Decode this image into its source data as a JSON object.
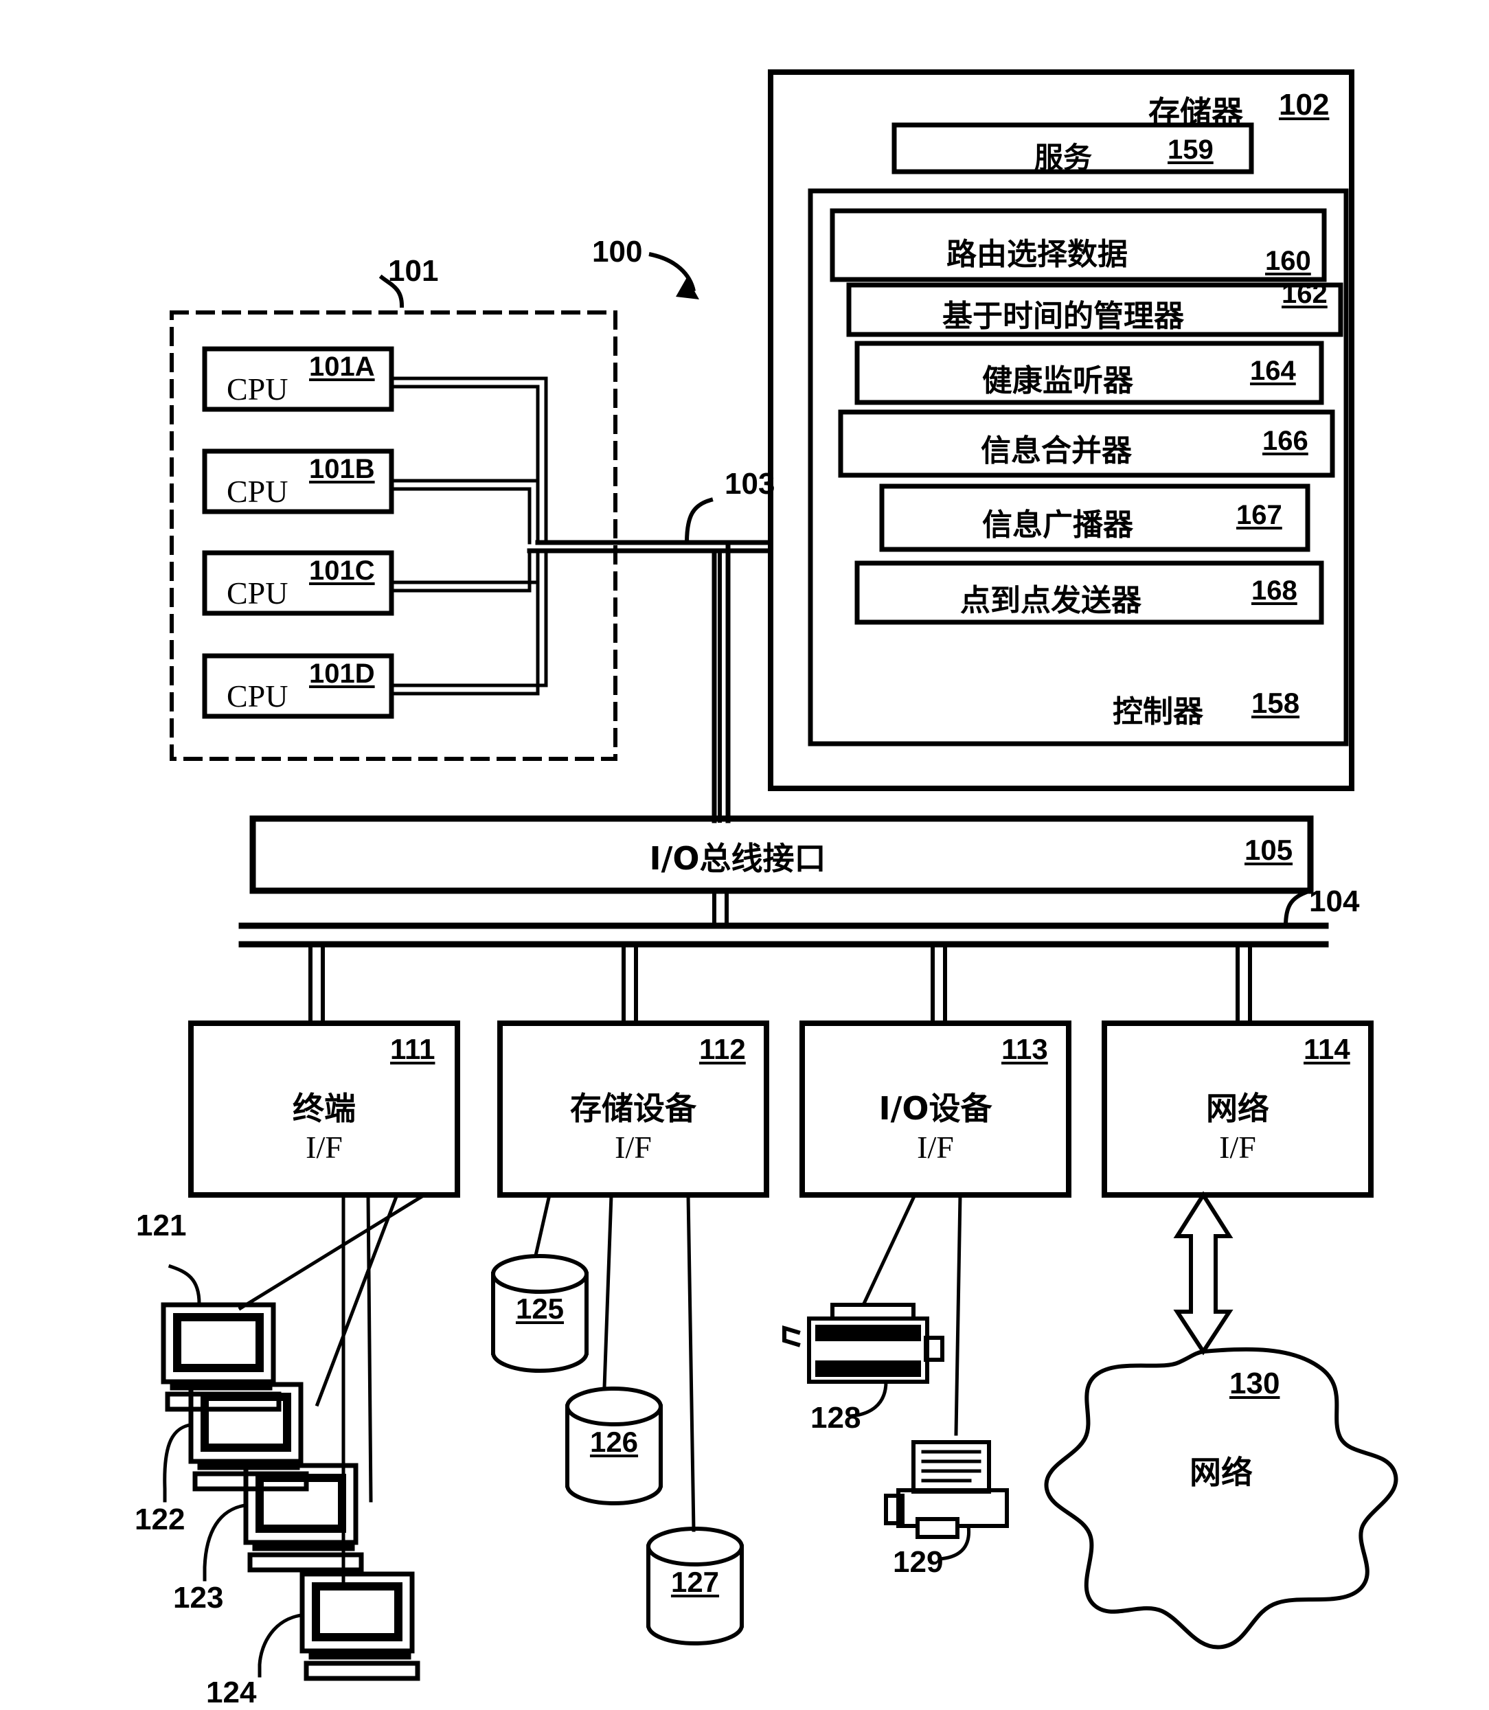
{
  "figure": {
    "system_ref": "100",
    "cpu_group": {
      "ref": "101",
      "cpus": [
        {
          "label": "CPU",
          "ref": "101A"
        },
        {
          "label": "CPU",
          "ref": "101B"
        },
        {
          "label": "CPU",
          "ref": "101C"
        },
        {
          "label": "CPU",
          "ref": "101D"
        }
      ]
    },
    "memory_bus_ref": "103",
    "io_bus_ref": "104",
    "memory": {
      "title": "存储器",
      "ref": "102",
      "service": {
        "title": "服务",
        "ref": "159"
      },
      "controller": {
        "title": "控制器",
        "ref": "158",
        "modules": [
          {
            "title": "路由选择数据",
            "ref": "160"
          },
          {
            "title": "基于时间的管理器",
            "ref": "162"
          },
          {
            "title": "健康监听器",
            "ref": "164"
          },
          {
            "title": "信息合并器",
            "ref": "166"
          },
          {
            "title": "信息广播器",
            "ref": "167"
          },
          {
            "title": "点到点发送器",
            "ref": "168"
          }
        ]
      }
    },
    "io_bus_interface": {
      "title": "I/O总线接口",
      "ref": "105"
    },
    "interfaces": [
      {
        "title": "终端",
        "sub": "I/F",
        "ref": "111"
      },
      {
        "title": "存储设备",
        "sub": "I/F",
        "ref": "112"
      },
      {
        "title": "I/O设备",
        "sub": "I/F",
        "ref": "113"
      },
      {
        "title": "网络",
        "sub": "I/F",
        "ref": "114"
      }
    ],
    "terminals": [
      {
        "ref": "121"
      },
      {
        "ref": "122"
      },
      {
        "ref": "123"
      },
      {
        "ref": "124"
      }
    ],
    "storage_devices": [
      {
        "ref": "125"
      },
      {
        "ref": "126"
      },
      {
        "ref": "127"
      }
    ],
    "io_devices": [
      {
        "ref": "128",
        "kind": "scanner-icon"
      },
      {
        "ref": "129",
        "kind": "printer-icon"
      }
    ],
    "network_cloud": {
      "title": "网络",
      "ref": "130"
    }
  },
  "colors": {
    "ink": "#000000",
    "paper": "#ffffff"
  }
}
